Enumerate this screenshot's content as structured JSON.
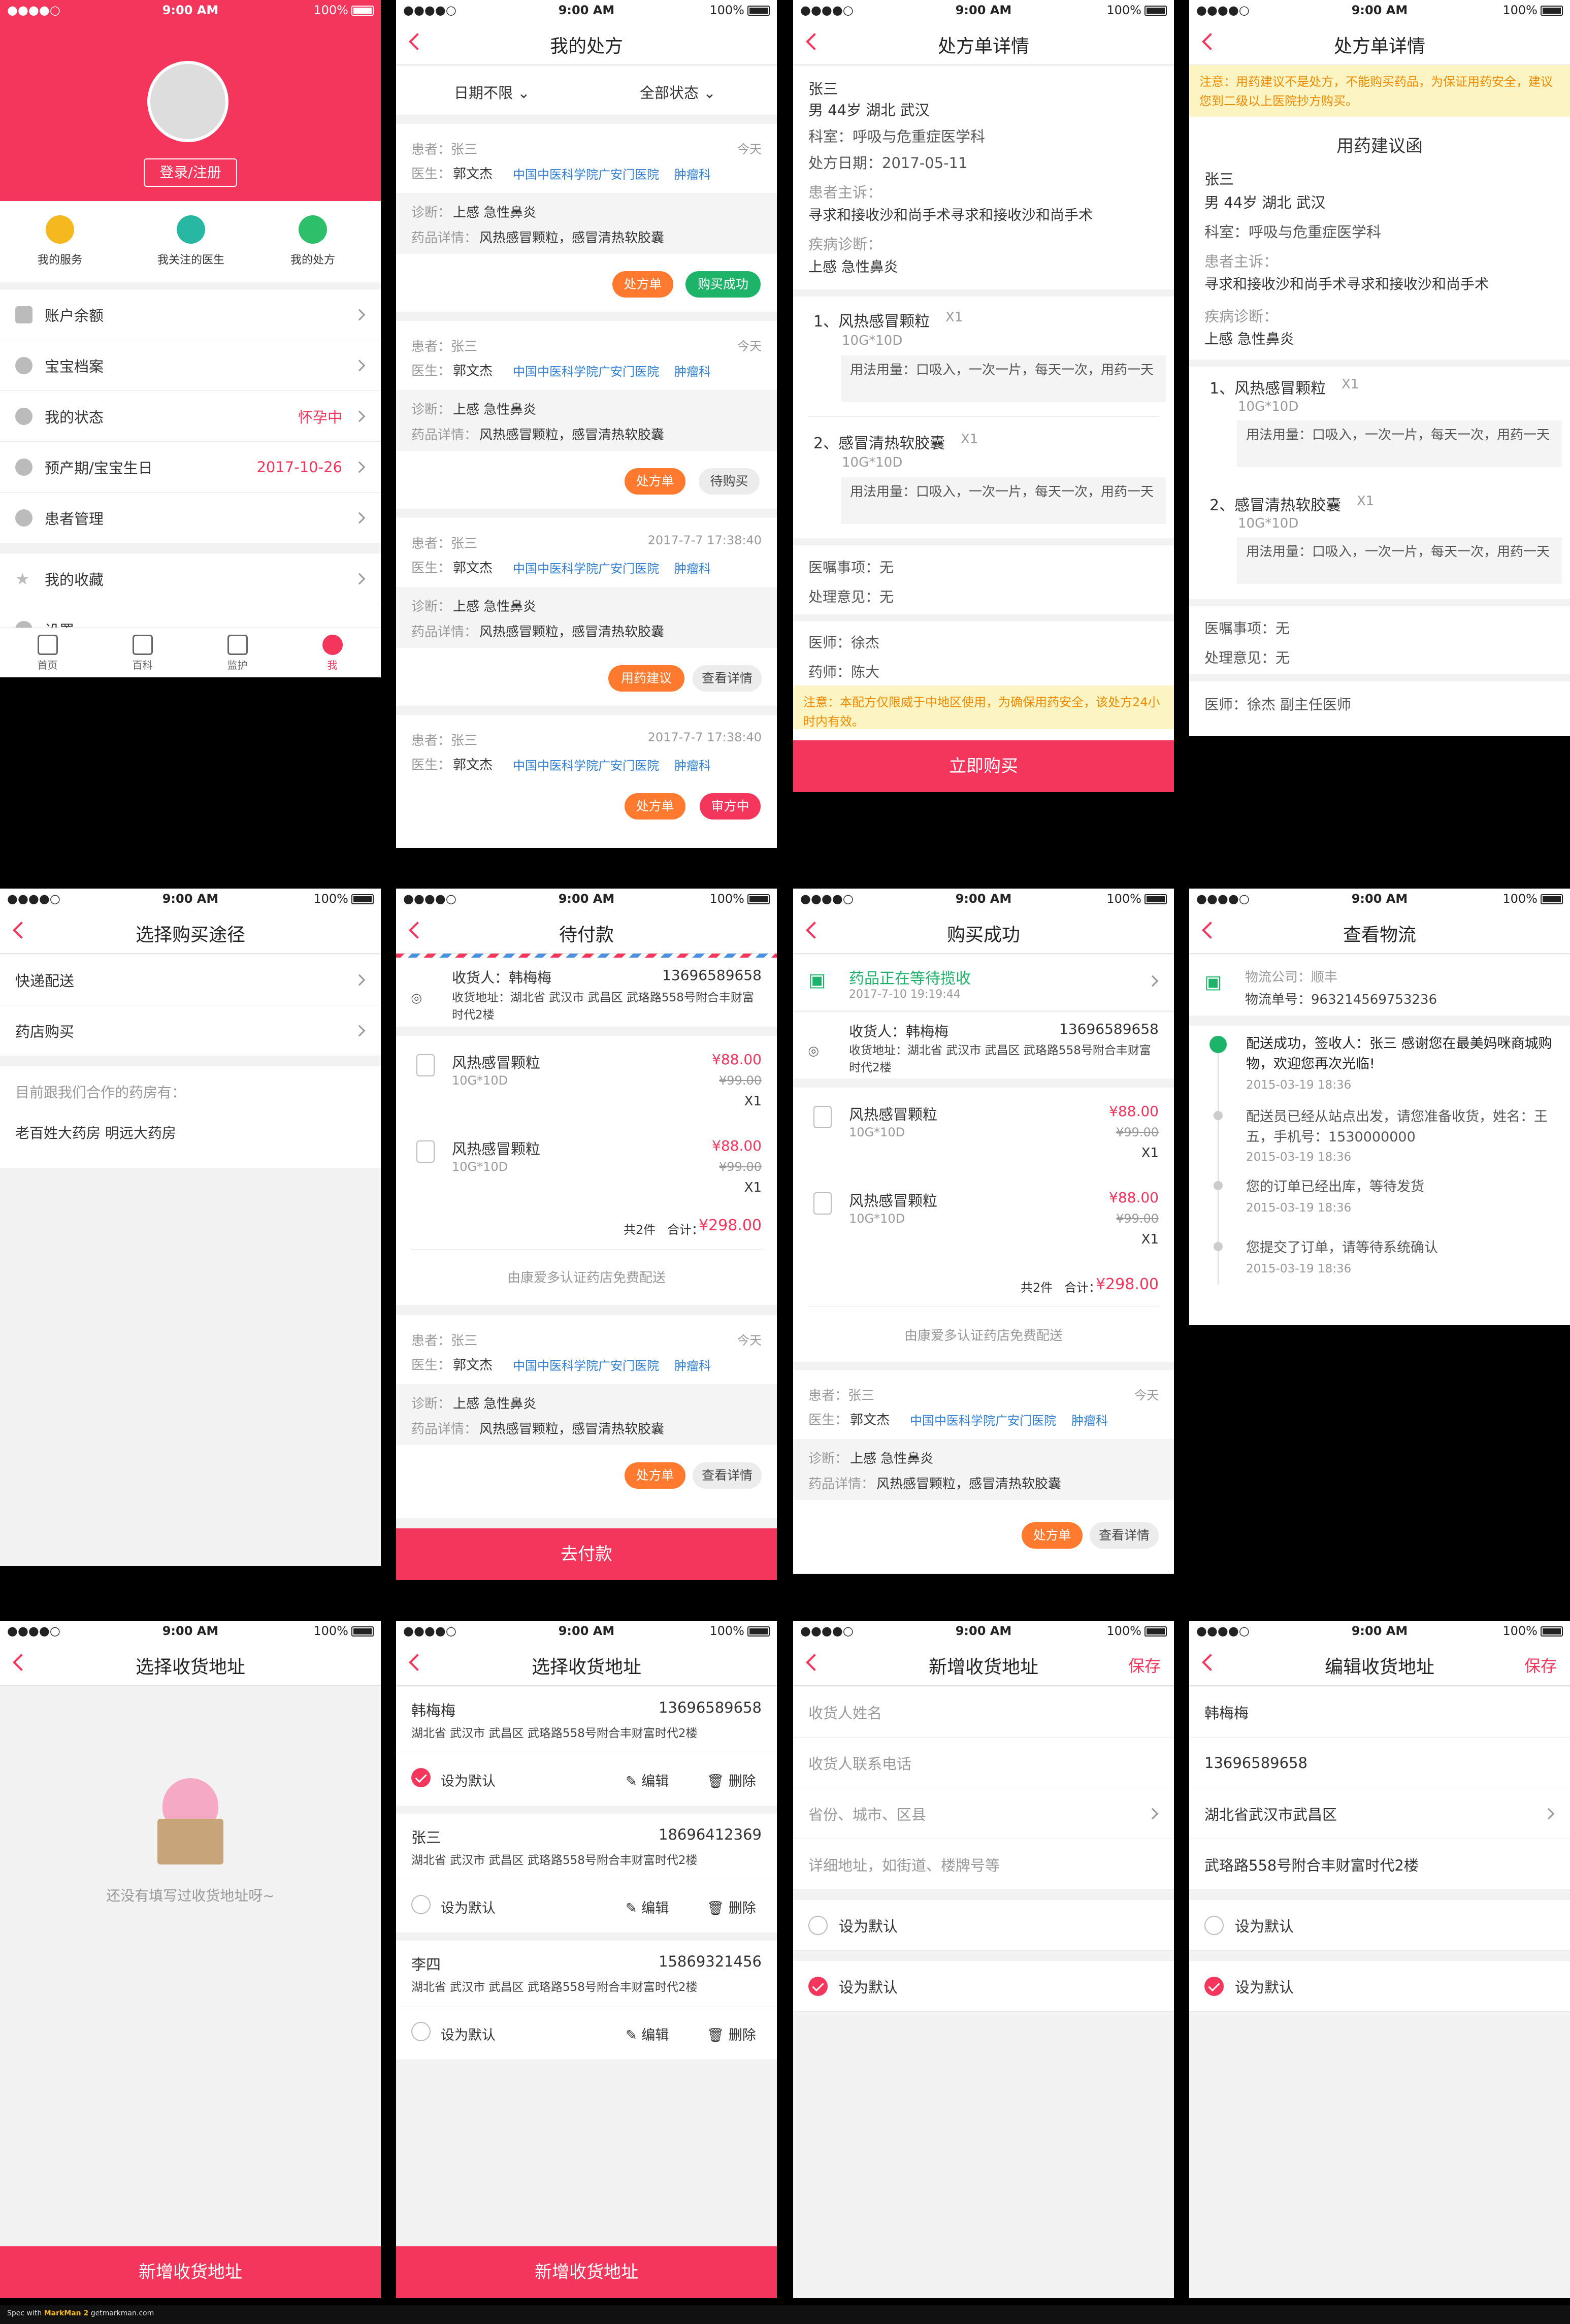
{
  "status": {
    "carrier": "●●●●○",
    "time": "9:00 AM",
    "battery": "100%"
  },
  "s1": {
    "login": "登录/注册",
    "quick": [
      "我的服务",
      "我关注的医生",
      "我的处方"
    ],
    "rows": [
      {
        "label": "账户余额",
        "value": ""
      },
      {
        "label": "宝宝档案",
        "value": ""
      },
      {
        "label": "我的状态",
        "value": "怀孕中"
      },
      {
        "label": "预产期/宝宝生日",
        "value": "2017-10-26"
      },
      {
        "label": "患者管理",
        "value": ""
      },
      {
        "label": "我的收藏",
        "value": ""
      },
      {
        "label": "设置",
        "value": ""
      }
    ],
    "tabs": [
      "首页",
      "百科",
      "监护",
      "我"
    ]
  },
  "s2": {
    "title": "我的处方",
    "filter_date": "日期不限",
    "filter_status": "全部状态",
    "cards": [
      {
        "patient": "患者：张三",
        "time": "今天",
        "doctor_lbl": "医生：",
        "doctor": "郭文杰",
        "hospital": "中国中医科学院广安门医院",
        "dept": "肿瘤科",
        "diag_lbl": "诊断：",
        "diag": "上感  急性鼻炎",
        "drug_lbl": "药品详情：",
        "drug": "风热感冒颗粒，感冒清热软胶囊",
        "btn1": "处方单",
        "btn2": "购买成功"
      },
      {
        "patient": "患者：张三",
        "time": "今天",
        "doctor_lbl": "医生：",
        "doctor": "郭文杰",
        "hospital": "中国中医科学院广安门医院",
        "dept": "肿瘤科",
        "diag_lbl": "诊断：",
        "diag": "上感  急性鼻炎",
        "drug_lbl": "药品详情：",
        "drug": "风热感冒颗粒，感冒清热软胶囊",
        "btn1": "处方单",
        "btn2": "待购买"
      },
      {
        "patient": "患者：张三",
        "time": "2017-7-7 17:38:40",
        "doctor_lbl": "医生：",
        "doctor": "郭文杰",
        "hospital": "中国中医科学院广安门医院",
        "dept": "肿瘤科",
        "diag_lbl": "诊断：",
        "diag": "上感  急性鼻炎",
        "drug_lbl": "药品详情：",
        "drug": "风热感冒颗粒，感冒清热软胶囊",
        "btn1": "用药建议",
        "btn2": "查看详情"
      },
      {
        "patient": "患者：张三",
        "time": "2017-7-7 17:38:40",
        "doctor_lbl": "医生：",
        "doctor": "郭文杰",
        "hospital": "中国中医科学院广安门医院",
        "dept": "肿瘤科",
        "btn1": "处方单",
        "btn2": "审方中"
      }
    ]
  },
  "s3": {
    "title": "处方单详情",
    "name": "张三",
    "info": "男    44岁    湖北    武汉",
    "dept": "科室：呼吸与危重症医学科",
    "date": "处方日期：2017-05-11",
    "complaint_lbl": "患者主诉：",
    "complaint": "寻求和接收沙和尚手术寻求和接收沙和尚手术",
    "diag_lbl": "疾病诊断：",
    "diag": "上感  急性鼻炎",
    "drugs": [
      {
        "name": "1、风热感冒颗粒",
        "qty": "X1",
        "spec": "10G*10D",
        "usage": "用法用量：口吸入，一次一片，每天一次，用药一天"
      },
      {
        "name": "2、感冒清热软胶囊",
        "qty": "X1",
        "spec": "10G*10D",
        "usage": "用法用量：口吸入，一次一片，每天一次，用药一天"
      }
    ],
    "advice": "医嘱事项：无",
    "opinion": "处理意见：无",
    "doctor": "医师：徐杰",
    "pharm": "药师：陈大",
    "note": "注意：本配方仅限威于中地区使用，为确保用药安全，该处方24小时内有效。",
    "buy": "立即购买"
  },
  "s4": {
    "title": "处方单详情",
    "note": "注意：用药建议不是处方，不能购买药品，为保证用药安全，建议您到二级以上医院抄方购买。",
    "heading": "用药建议函",
    "name": "张三",
    "info": "男    44岁    湖北    武汉",
    "dept": "科室：呼吸与危重症医学科",
    "complaint_lbl": "患者主诉：",
    "complaint": "寻求和接收沙和尚手术寻求和接收沙和尚手术",
    "diag_lbl": "疾病诊断：",
    "diag": "上感  急性鼻炎",
    "drugs": [
      {
        "name": "1、风热感冒颗粒",
        "qty": "X1",
        "spec": "10G*10D",
        "usage": "用法用量：口吸入，一次一片，每天一次，用药一天"
      },
      {
        "name": "2、感冒清热软胶囊",
        "qty": "X1",
        "spec": "10G*10D",
        "usage": "用法用量：口吸入，一次一片，每天一次，用药一天"
      }
    ],
    "advice": "医嘱事项：无",
    "opinion": "处理意见：无",
    "doctor": "医师：徐杰    副主任医师"
  },
  "s5": {
    "title": "选择购买途径",
    "opt1": "快递配送",
    "opt2": "药店购买",
    "coop": "目前跟我们合作的药房有：",
    "stores": "老百姓大药房      明远大药房"
  },
  "s6": {
    "title": "待付款",
    "receiver": "收货人：韩梅梅",
    "phone": "13696589658",
    "addr": "收货地址：湖北省 武汉市 武昌区 武珞路558号附合丰财富时代2楼",
    "items": [
      {
        "name": "风热感冒颗粒",
        "spec": "10G*10D",
        "price": "¥88.00",
        "old": "¥99.00",
        "qty": "X1"
      },
      {
        "name": "风热感冒颗粒",
        "spec": "10G*10D",
        "price": "¥88.00",
        "old": "¥99.00",
        "qty": "X1"
      }
    ],
    "count": "共2件",
    "total_lbl": "合计：",
    "total": "¥298.00",
    "ship": "由康爱多认证药店免费配送",
    "card": {
      "patient": "患者：张三",
      "time": "今天",
      "doctor_lbl": "医生：",
      "doctor": "郭文杰",
      "hospital": "中国中医科学院广安门医院",
      "dept": "肿瘤科",
      "diag_lbl": "诊断：",
      "diag": "上感  急性鼻炎",
      "drug_lbl": "药品详情：",
      "drug": "风热感冒颗粒，感冒清热软胶囊",
      "btn1": "处方单",
      "btn2": "查看详情"
    },
    "pay": "去付款"
  },
  "s7": {
    "title": "购买成功",
    "status": "药品正在等待揽收",
    "status_time": "2017-7-10 19:19:44",
    "receiver": "收货人：韩梅梅",
    "phone": "13696589658",
    "addr": "收货地址：湖北省 武汉市 武昌区 武珞路558号附合丰财富时代2楼",
    "items": [
      {
        "name": "风热感冒颗粒",
        "spec": "10G*10D",
        "price": "¥88.00",
        "old": "¥99.00",
        "qty": "X1"
      },
      {
        "name": "风热感冒颗粒",
        "spec": "10G*10D",
        "price": "¥88.00",
        "old": "¥99.00",
        "qty": "X1"
      }
    ],
    "count": "共2件",
    "total_lbl": "合计：",
    "total": "¥298.00",
    "ship": "由康爱多认证药店免费配送",
    "card": {
      "patient": "患者：张三",
      "time": "今天",
      "doctor_lbl": "医生：",
      "doctor": "郭文杰",
      "hospital": "中国中医科学院广安门医院",
      "dept": "肿瘤科",
      "diag_lbl": "诊断：",
      "diag": "上感  急性鼻炎",
      "drug_lbl": "药品详情：",
      "drug": "风热感冒颗粒，感冒清热软胶囊",
      "btn1": "处方单",
      "btn2": "查看详情"
    }
  },
  "s8": {
    "title": "查看物流",
    "company": "物流公司：顺丰",
    "number": "物流单号：963214569753236",
    "events": [
      {
        "text": "配送成功，签收人：张三 感谢您在最美妈咪商城购物，欢迎您再次光临!",
        "time": "2015-03-19 18:36"
      },
      {
        "text": "配送员已经从站点出发，请您准备收货，姓名：王五，手机号：1530000000",
        "time": "2015-03-19 18:36"
      },
      {
        "text": "您的订单已经出库，等待发货",
        "time": "2015-03-19 18:36"
      },
      {
        "text": "您提交了订单，请等待系统确认",
        "time": "2015-03-19 18:36"
      }
    ]
  },
  "s9": {
    "title": "选择收货地址",
    "empty": "还没有填写过收货地址呀~",
    "add": "新增收货地址"
  },
  "s10": {
    "title": "选择收货地址",
    "set_default": "设为默认",
    "edit": "编辑",
    "delete": "删除",
    "add": "新增收货地址",
    "addrs": [
      {
        "name": "韩梅梅",
        "phone": "13696589658",
        "addr": "湖北省 武汉市 武昌区 武珞路558号附合丰财富时代2楼"
      },
      {
        "name": "张三",
        "phone": "18696412369",
        "addr": "湖北省 武汉市 武昌区 武珞路558号附合丰财富时代2楼"
      },
      {
        "name": "李四",
        "phone": "15869321456",
        "addr": "湖北省 武汉市 武昌区 武珞路558号附合丰财富时代2楼"
      }
    ]
  },
  "s11": {
    "title": "新增收货地址",
    "save": "保存",
    "name_ph": "收货人姓名",
    "phone_ph": "收货人联系电话",
    "region_ph": "省份、城市、区县",
    "detail_ph": "详细地址，如街道、楼牌号等",
    "default1": "设为默认",
    "default2": "设为默认"
  },
  "s12": {
    "title": "编辑收货地址",
    "save": "保存",
    "name": "韩梅梅",
    "phone": "13696589658",
    "region": "湖北省武汉市武昌区",
    "detail": "武珞路558号附合丰财富时代2楼",
    "default1": "设为默认",
    "default2": "设为默认"
  },
  "footer": {
    "brand": "Spec with",
    "tool": "MarkMan 2",
    "site": "getmarkman.com"
  },
  "colors": {
    "accent": "#f5365c",
    "orange": "#ff7a2e",
    "green": "#1db46a",
    "link": "#2f7fd6"
  }
}
